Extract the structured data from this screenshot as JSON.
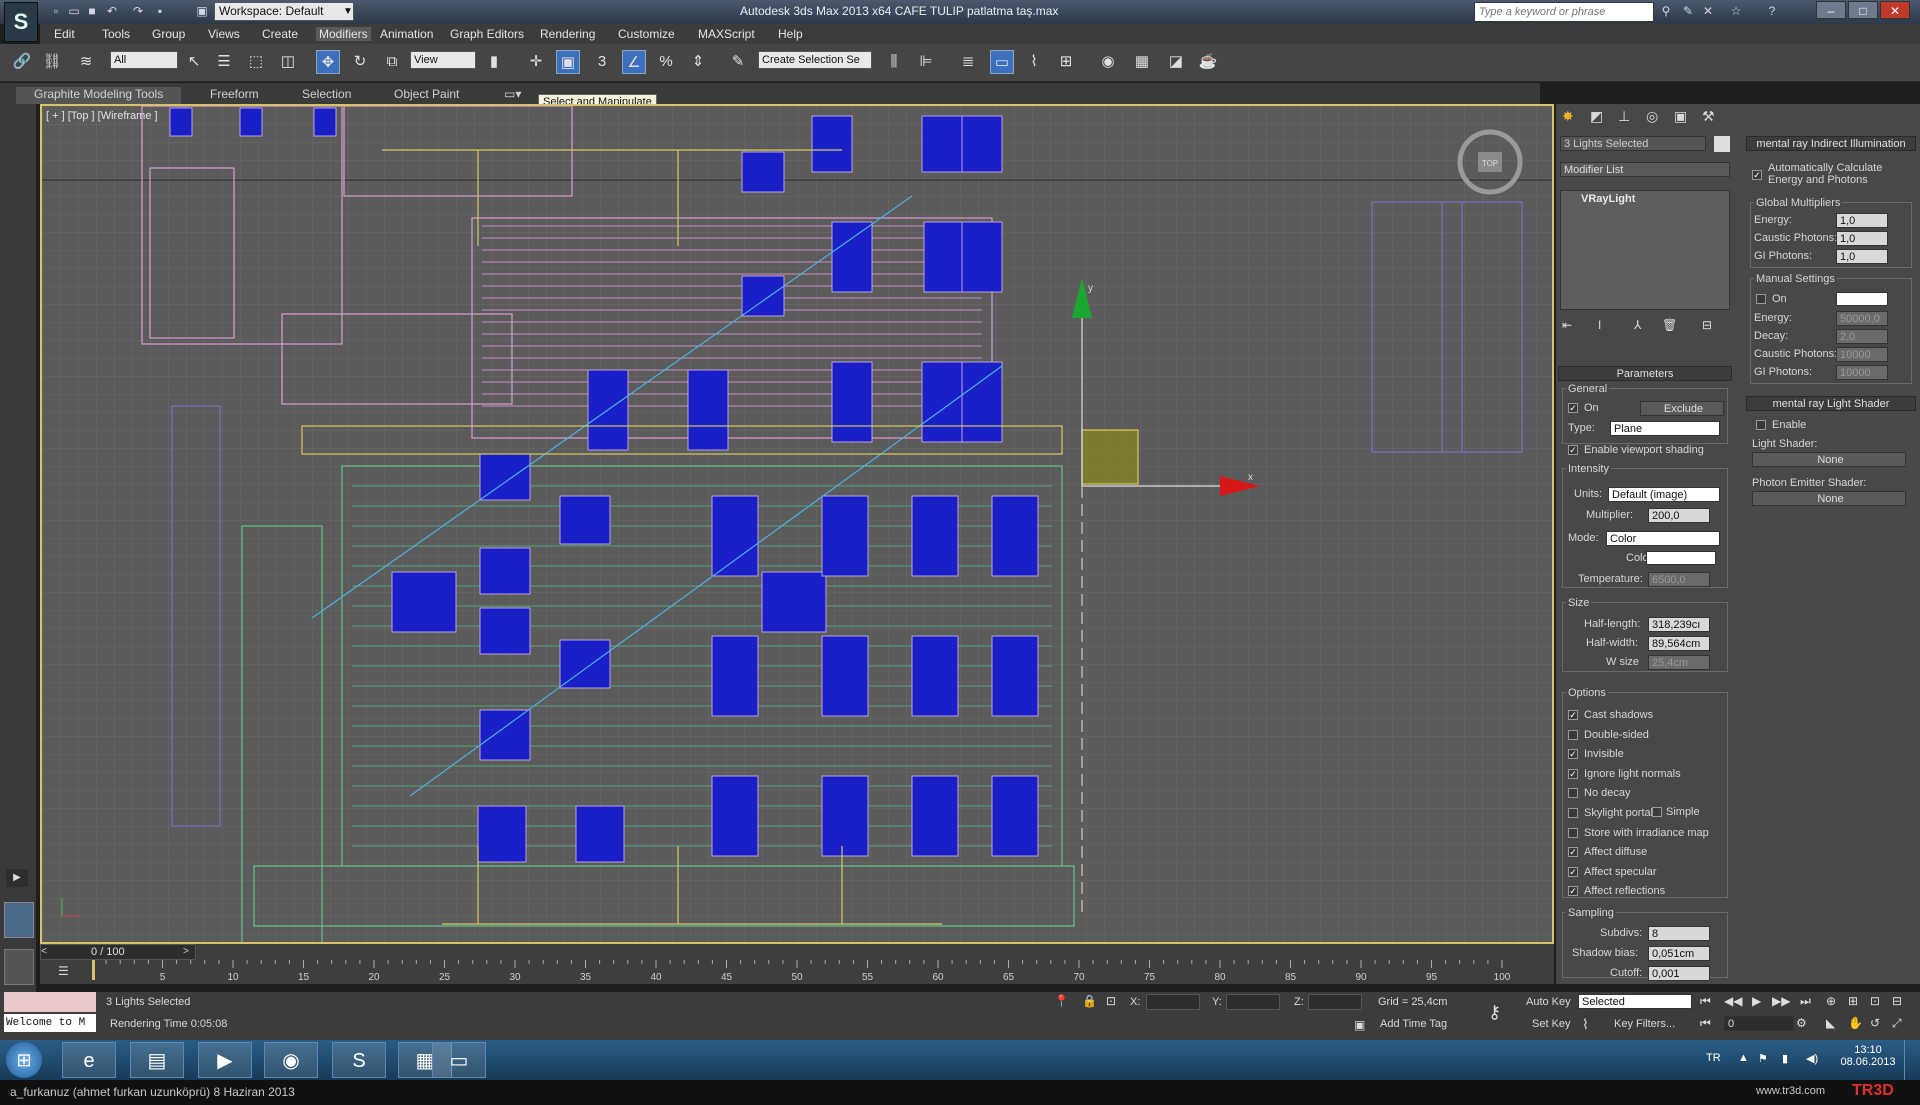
{
  "title_bar": {
    "workspace_label": "Workspace: Default",
    "app_title": "Autodesk 3ds Max  2013 x64     CAFE TULIP patlatma taş.max",
    "search_placeholder": "Type a keyword or phrase"
  },
  "menu": [
    "Edit",
    "Tools",
    "Group",
    "Views",
    "Create",
    "Modifiers",
    "Animation",
    "Graph Editors",
    "Rendering",
    "Customize",
    "MAXScript",
    "Help"
  ],
  "toolbar": {
    "filter_value": "All",
    "refcoord_value": "View",
    "selection_set_placeholder": "Create Selection Se"
  },
  "ribbon": {
    "tabs": [
      "Graphite Modeling Tools",
      "Freeform",
      "Selection",
      "Object Paint"
    ],
    "tooltip": "Select and Manipulate"
  },
  "viewport": {
    "label": "[ + ] [Top ] [Wireframe ]",
    "viewcube_label": "TOP",
    "axis_x": "x",
    "axis_y": "y"
  },
  "command_panel": {
    "selection_name": "3 Lights Selected",
    "modifier_list": "Modifier List",
    "stack_item": "VRayLight",
    "parameters_title": "Parameters",
    "general": {
      "title": "General",
      "on_label": "On",
      "on_checked": true,
      "exclude_label": "Exclude",
      "type_label": "Type:",
      "type_value": "Plane",
      "viewport_shading_label": "Enable viewport shading",
      "viewport_shading_checked": true
    },
    "intensity": {
      "title": "Intensity",
      "units_label": "Units:",
      "units_value": "Default (image)",
      "multiplier_label": "Multiplier:",
      "multiplier_value": "200,0",
      "mode_label": "Mode:",
      "mode_value": "Color",
      "color_label": "Color:",
      "color_value": "#ffffff",
      "temperature_label": "Temperature:",
      "temperature_value": "6500,0"
    },
    "size": {
      "title": "Size",
      "half_length_label": "Half-length:",
      "half_length_value": "318,239cı",
      "half_width_label": "Half-width:",
      "half_width_value": "89,564cm",
      "w_size_label": "W size",
      "w_size_value": "25,4cm"
    },
    "options": {
      "title": "Options",
      "items": [
        {
          "label": "Cast shadows",
          "checked": true
        },
        {
          "label": "Double-sided",
          "checked": false
        },
        {
          "label": "Invisible",
          "checked": true
        },
        {
          "label": "Ignore light normals",
          "checked": true
        },
        {
          "label": "No decay",
          "checked": false
        },
        {
          "label": "Skylight portal",
          "checked": false
        },
        {
          "label": "Store with irradiance map",
          "checked": false
        },
        {
          "label": "Affect diffuse",
          "checked": true
        },
        {
          "label": "Affect specular",
          "checked": true
        },
        {
          "label": "Affect reflections",
          "checked": true
        }
      ],
      "simple_label": "Simple"
    },
    "sampling": {
      "title": "Sampling",
      "subdivs_label": "Subdivs:",
      "subdivs_value": "8",
      "shadow_bias_label": "Shadow bias:",
      "shadow_bias_value": "0,051cm",
      "cutoff_label": "Cutoff:",
      "cutoff_value": "0,001"
    }
  },
  "mr_panel": {
    "title": "mental ray Indirect Illumination",
    "auto_calc_label": "Automatically Calculate Energy and Photons",
    "auto_calc_checked": true,
    "global_title": "Global Multipliers",
    "global": [
      {
        "label": "Energy:",
        "value": "1,0"
      },
      {
        "label": "Caustic Photons:",
        "value": "1,0"
      },
      {
        "label": "GI Photons:",
        "value": "1,0"
      }
    ],
    "manual_title": "Manual Settings",
    "manual_on_label": "On",
    "manual": [
      {
        "label": "Energy:",
        "value": "50000,0"
      },
      {
        "label": "Decay:",
        "value": "2,0"
      },
      {
        "label": "Caustic Photons:",
        "value": "10000"
      },
      {
        "label": "GI Photons:",
        "value": "10000"
      }
    ],
    "shader_title": "mental ray Light Shader",
    "enable_label": "Enable",
    "light_shader_label": "Light Shader:",
    "light_shader_value": "None",
    "photon_shader_label": "Photon Emitter Shader:",
    "photon_shader_value": "None"
  },
  "timeline": {
    "frame_counter": "0 / 100",
    "ticks": [
      "0",
      "5",
      "10",
      "15",
      "20",
      "25",
      "30",
      "35",
      "40",
      "45",
      "50",
      "55",
      "60",
      "65",
      "70",
      "75",
      "80",
      "85",
      "90",
      "95",
      "100"
    ]
  },
  "status": {
    "listener": "Welcome to M",
    "selection_status": "3 Lights Selected",
    "render_time": "Rendering Time  0:05:08",
    "x_label": "X:",
    "y_label": "Y:",
    "z_label": "Z:",
    "grid": "Grid = 25,4cm",
    "add_time_tag": "Add Time Tag",
    "auto_key": "Auto Key",
    "set_key": "Set Key",
    "key_mode_value": "Selected",
    "key_filters": "Key Filters...",
    "frame_value": "0"
  },
  "taskbar": {
    "lang": "TR",
    "time": "13:10",
    "date": "08.06.2013"
  },
  "footer": {
    "credit": "a_furkanuz (ahmet furkan uzunköprü)  8 Haziran 2013",
    "site": "www.tr3d.com",
    "brand": "TR3D"
  }
}
